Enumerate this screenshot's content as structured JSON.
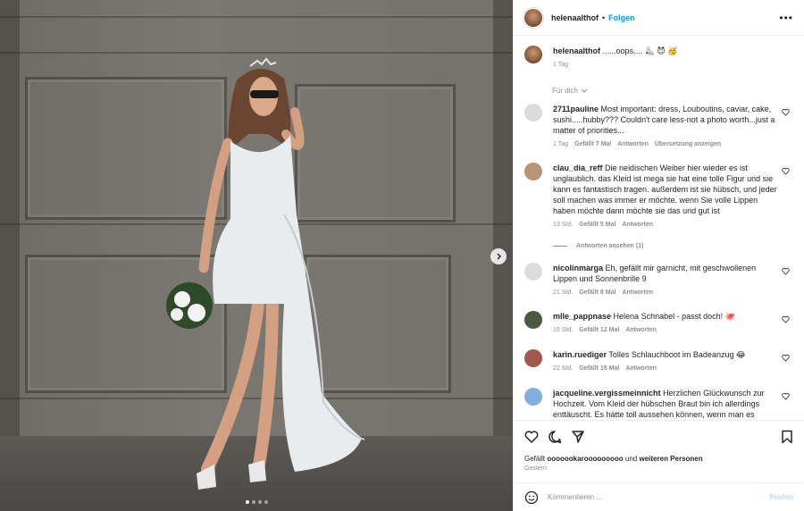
{
  "post": {
    "username": "helenaalthof",
    "separator": "•",
    "follow_label": "Folgen",
    "more_label": "•••",
    "caption_text": "......oops....",
    "caption_emoji": "⛸️ 😈 🥳",
    "caption_time": "1 Tag",
    "sort_label": "Für dich"
  },
  "comments": [
    {
      "user": "2711pauline",
      "text": "Most important: dress, Louboutins, caviar, cake, sushi.....hubby??? Couldn't care less-not a photo worth...just a matter of priorities...",
      "time": "1 Tag",
      "likes": "Gefällt 7 Mal",
      "reply": "Antworten",
      "translate": "Übersetzung anzeigen",
      "avatar_color": "#dcdcdc"
    },
    {
      "user": "clau_dia_reff",
      "text": "Die neidischen Weiber hier wieder es ist unglaublich. das Kleid ist mega sie hat eine tolle Figur und sie kann es fantastisch tragen. außerdem ist sie hübsch, und jeder soll machen was immer er möchte. wenn Sie volle Lippen haben möchte dann möchte sie das und gut ist",
      "time": "13 Std.",
      "likes": "Gefällt 5 Mal",
      "reply": "Antworten",
      "view_replies": "Antworten ansehen (1)",
      "avatar_color": "#b89478"
    },
    {
      "user": "nicolinmarga",
      "text": "Eh, gefällt mir garnicht, mit geschwollenen Lippen und Sonnenbrille 9",
      "time": "21 Std.",
      "likes": "Gefällt 8 Mal",
      "reply": "Antworten",
      "avatar_color": "#dcdcdc"
    },
    {
      "user": "mlle_pappnase",
      "text": "Helena Schnabel - passt doch! 🐙",
      "time": "19 Std.",
      "likes": "Gefällt 12 Mal",
      "reply": "Antworten",
      "avatar_color": "#4a5a40"
    },
    {
      "user": "karin.ruediger",
      "text": "Tolles Schlauchboot im Badeanzug 😂",
      "time": "22 Std.",
      "likes": "Gefällt 15 Mal",
      "reply": "Antworten",
      "avatar_color": "#a0584a"
    },
    {
      "user": "jacqueline.vergissmeinnicht",
      "text": "Herzlichen Glückwunsch zur Hochzeit. Vom Kleid der hübschen Braut bin ich allerdings enttäuscht. Es hätte toll aussehen können, wenn man es",
      "avatar_color": "#7fb0e0"
    }
  ],
  "likes_summary": {
    "prefix": "Gefällt",
    "user": "ooooookarooooooooo",
    "connector": "und",
    "others": "weiteren Personen",
    "date": "Gestern"
  },
  "composer": {
    "placeholder": "Kommentieren ...",
    "post_label": "Posten"
  },
  "icons": [
    "heart-icon",
    "comment-icon",
    "share-icon",
    "bookmark-icon",
    "emoji-icon",
    "chevron-right-icon",
    "chevron-down-icon",
    "more-icon"
  ],
  "colors": {
    "accent": "#0095f6",
    "muted": "#8e8e8e",
    "post_disabled": "#b2dffc"
  },
  "carousel": {
    "slides": 4,
    "active_index": 1
  }
}
